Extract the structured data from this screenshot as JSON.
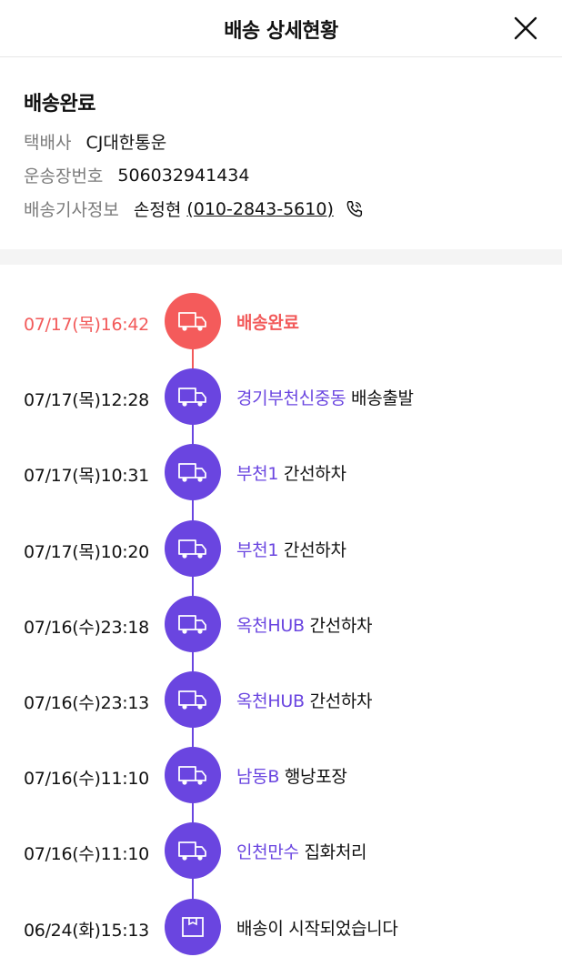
{
  "header": {
    "title": "배송 상세현황"
  },
  "summary": {
    "status": "배송완료",
    "courier_label": "택배사",
    "courier_value": "CJ대한통운",
    "tracking_label": "운송장번호",
    "tracking_value": "506032941434",
    "driver_label": "배송기사정보",
    "driver_name": "손정현",
    "driver_phone": "(010-2843-5610)"
  },
  "colors": {
    "accent_purple": "#6a45e0",
    "accent_red": "#f25a5a"
  },
  "timeline": [
    {
      "time": "07/17(목)16:42",
      "location": "",
      "event": "배송완료",
      "icon": "truck-icon",
      "active": true
    },
    {
      "time": "07/17(목)12:28",
      "location": "경기부천신중동",
      "event": "배송출발",
      "icon": "truck-icon",
      "active": false
    },
    {
      "time": "07/17(목)10:31",
      "location": "부천1",
      "event": "간선하차",
      "icon": "truck-icon",
      "active": false
    },
    {
      "time": "07/17(목)10:20",
      "location": "부천1",
      "event": "간선하차",
      "icon": "truck-icon",
      "active": false
    },
    {
      "time": "07/16(수)23:18",
      "location": "옥천HUB",
      "event": "간선하차",
      "icon": "truck-icon",
      "active": false
    },
    {
      "time": "07/16(수)23:13",
      "location": "옥천HUB",
      "event": "간선하차",
      "icon": "truck-icon",
      "active": false
    },
    {
      "time": "07/16(수)11:10",
      "location": "남동B",
      "event": "행낭포장",
      "icon": "truck-icon",
      "active": false
    },
    {
      "time": "07/16(수)11:10",
      "location": "인천만수",
      "event": "집화처리",
      "icon": "truck-icon",
      "active": false
    },
    {
      "time": "06/24(화)15:13",
      "location": "",
      "event": "배송이 시작되었습니다",
      "icon": "box-icon",
      "active": false
    }
  ]
}
